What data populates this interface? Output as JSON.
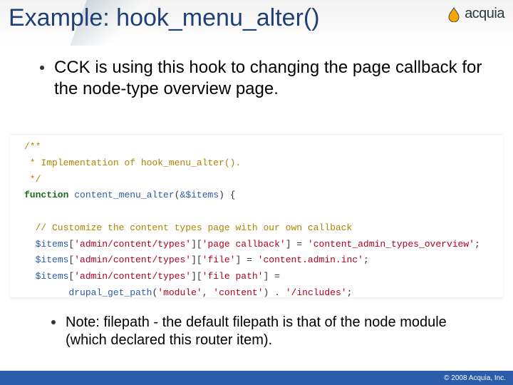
{
  "title": "Example: hook_menu_alter()",
  "logo": {
    "name": "acquia"
  },
  "bullet_main": "CCK is using this hook to changing the page callback for the node-type overview page.",
  "code": {
    "l1": "/**",
    "l2": " * Implementation of hook_menu_alter().",
    "l3": " */",
    "l4_key": "function",
    "l4_fn": "content_menu_alter",
    "l4_arg": "&$items",
    "l5": "  // Customize the content types page with our own callback",
    "l6_var": "$items",
    "l6_k1": "'admin/content/types'",
    "l6_k2": "'page callback'",
    "l6_val": "'content_admin_types_overview'",
    "l7_k2": "'file'",
    "l7_val": "'content.admin.inc'",
    "l8_k2": "'file path'",
    "l9_fn": "drupal_get_path",
    "l9_a1": "'module'",
    "l9_a2": "'content'",
    "l9_tail": "'/includes'"
  },
  "note": "Note: filepath - the default filepath is that of the node module (which declared this router item).",
  "footer": "© 2008 Acquia, Inc."
}
